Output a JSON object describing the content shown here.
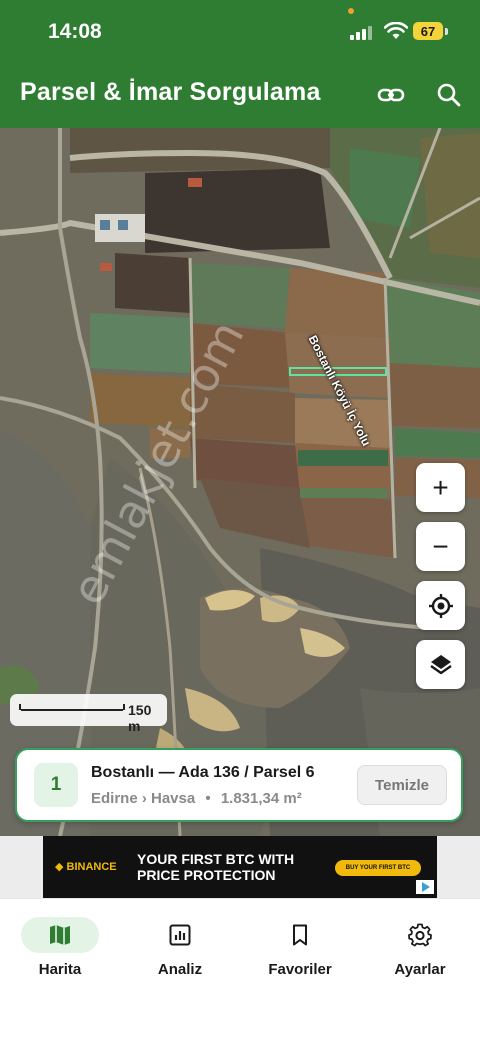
{
  "status_bar": {
    "time": "14:08",
    "battery": "67",
    "dot_color": "#f0a030",
    "battery_color": "#f5d33b"
  },
  "app_bar": {
    "title": "Parsel & İmar Sorgulama",
    "color": "#2f7d32",
    "icons": [
      "link-icon",
      "search-icon"
    ]
  },
  "map": {
    "road_label": "Bostanlı Köyü İç Yolu",
    "watermark": "emlakjet.com",
    "scale_label": "150 m",
    "controls": [
      "zoom-in-icon",
      "zoom-out-icon",
      "my-location-icon",
      "layers-icon"
    ],
    "zoom_in_glyph": "+",
    "zoom_out_glyph": "−"
  },
  "parcel": {
    "index": "1",
    "title": "Bostanlı — Ada 136 / Parsel 6",
    "location": "Edirne › Havsa",
    "separator": "•",
    "area": "1.831,34 m²",
    "clear_label": "Temizle",
    "accent": "#35a05c"
  },
  "ad": {
    "brand": "BINANCE",
    "headline": "YOUR FIRST BTC WITH PRICE PROTECTION",
    "cta": "BUY YOUR FIRST BTC"
  },
  "nav": {
    "items": [
      {
        "label": "Harita",
        "icon": "map-icon",
        "active": true
      },
      {
        "label": "Analiz",
        "icon": "chart-icon",
        "active": false
      },
      {
        "label": "Favoriler",
        "icon": "bookmark-icon",
        "active": false
      },
      {
        "label": "Ayarlar",
        "icon": "settings-icon",
        "active": false
      }
    ],
    "active_pill_color": "#e3f3e6"
  }
}
